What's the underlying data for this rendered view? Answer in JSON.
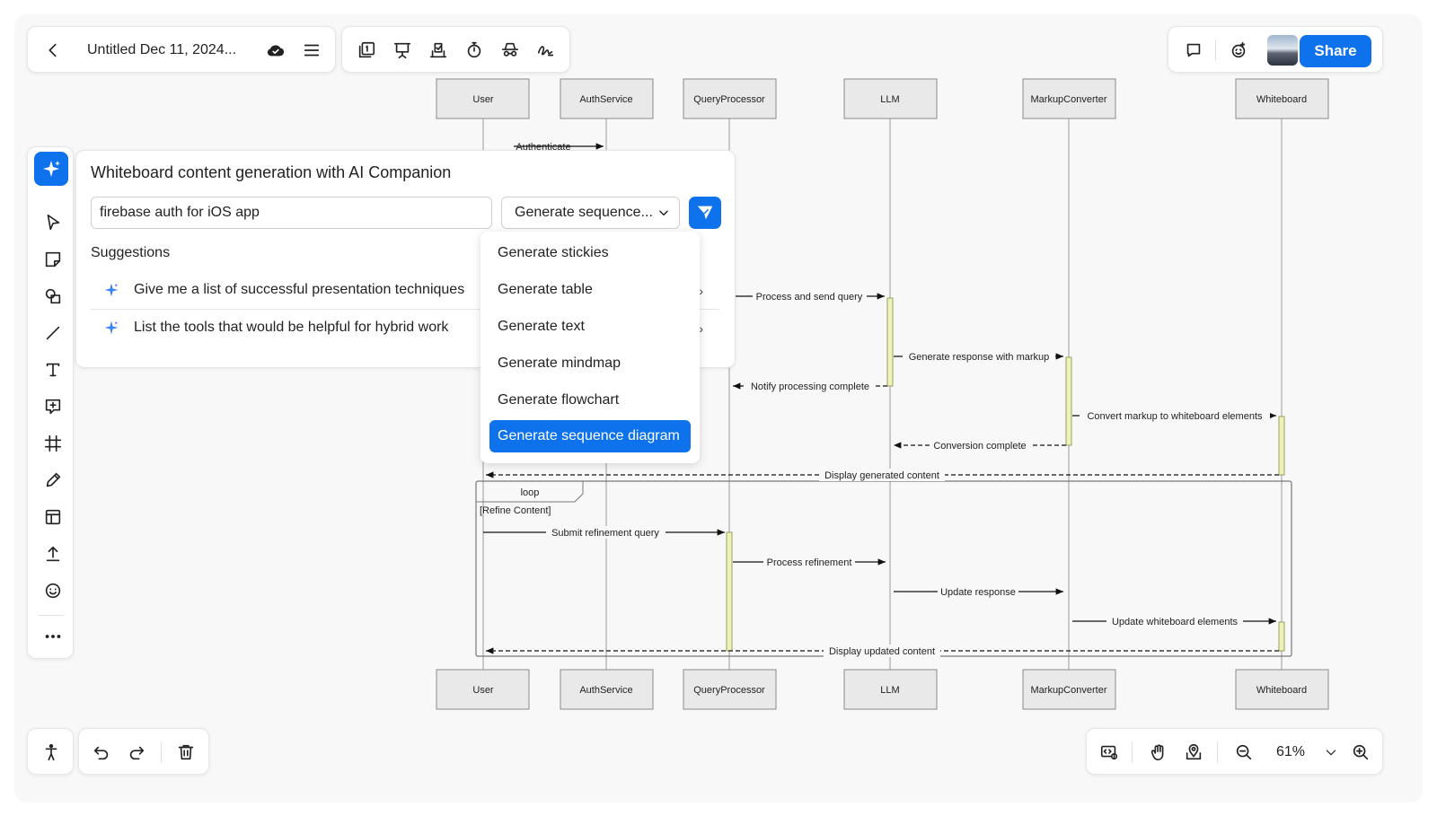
{
  "header": {
    "doc_title": "Untitled Dec 11, 2024...",
    "share_label": "Share"
  },
  "ai_panel": {
    "title": "Whiteboard content generation with AI Companion",
    "prompt_value": "firebase auth for iOS app",
    "selected_type": "Generate sequence...",
    "suggestions_label": "Suggestions",
    "suggestions": [
      "Give me a list of successful presentation techniques",
      "List the tools that would be helpful for hybrid work"
    ]
  },
  "dropdown": {
    "options": [
      "Generate stickies",
      "Generate table",
      "Generate text",
      "Generate mindmap",
      "Generate flowchart",
      "Generate sequence diagram"
    ],
    "selected_index": 5
  },
  "diagram": {
    "participants": [
      "User",
      "AuthService",
      "QueryProcessor",
      "LLM",
      "MarkupConverter",
      "Whiteboard"
    ],
    "partial_message": "Authenticate",
    "messages": [
      "Process and send query",
      "Generate response with markup",
      "Notify processing complete",
      "Convert markup to whiteboard elements",
      "Conversion complete",
      "Display generated content",
      "Submit refinement query",
      "Process refinement",
      "Update response",
      "Update whiteboard elements",
      "Display updated content"
    ],
    "loop_label": "loop",
    "loop_condition": "[Refine Content]"
  },
  "zoom": {
    "level": "61%"
  },
  "colors": {
    "accent": "#0e72ed",
    "activation": "#eef2b8"
  }
}
